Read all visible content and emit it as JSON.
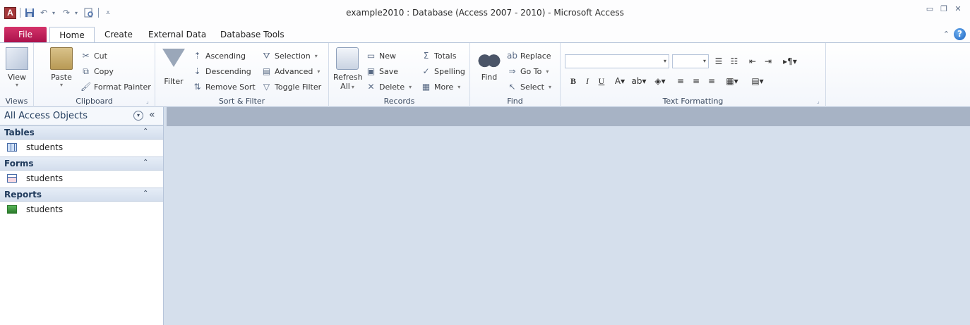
{
  "window": {
    "title": "example2010 : Database (Access 2007 - 2010)  -  Microsoft Access",
    "app_logo": "A",
    "controls": [
      "minimize-icon",
      "restore-icon",
      "close-icon"
    ]
  },
  "qat": {
    "icons": [
      "save-icon",
      "undo-icon",
      "redo-icon",
      "print-preview-icon",
      "customize-dropdown-icon"
    ]
  },
  "tabs": [
    {
      "key": "file",
      "label": "File"
    },
    {
      "key": "home",
      "label": "Home",
      "active": true
    },
    {
      "key": "create",
      "label": "Create"
    },
    {
      "key": "external",
      "label": "External Data"
    },
    {
      "key": "dbtools",
      "label": "Database Tools"
    }
  ],
  "ribbon": {
    "views": {
      "label": "Views",
      "view_btn": "View",
      "icon": "design-view-icon"
    },
    "clipboard": {
      "label": "Clipboard",
      "paste": "Paste",
      "cut": "Cut",
      "copy": "Copy",
      "format_painter": "Format Painter"
    },
    "sort_filter": {
      "label": "Sort & Filter",
      "filter": "Filter",
      "ascending": "Ascending",
      "descending": "Descending",
      "remove_sort": "Remove Sort",
      "selection": "Selection",
      "advanced": "Advanced",
      "toggle_filter": "Toggle Filter"
    },
    "records": {
      "label": "Records",
      "refresh": "Refresh",
      "refresh_sub": "All",
      "new": "New",
      "save": "Save",
      "delete": "Delete",
      "totals": "Totals",
      "spelling": "Spelling",
      "more": "More"
    },
    "find": {
      "label": "Find",
      "find": "Find",
      "replace": "Replace",
      "goto": "Go To",
      "select": "Select"
    },
    "text_formatting": {
      "label": "Text Formatting",
      "font_name": "",
      "font_size": "",
      "bold": "B",
      "italic": "I",
      "underline": "U"
    }
  },
  "nav": {
    "title": "All Access Objects",
    "groups": [
      {
        "label": "Tables",
        "items": [
          {
            "label": "students",
            "icon": "table-icon"
          }
        ]
      },
      {
        "label": "Forms",
        "items": [
          {
            "label": "students",
            "icon": "form-icon"
          }
        ]
      },
      {
        "label": "Reports",
        "items": [
          {
            "label": "students",
            "icon": "report-icon"
          }
        ]
      }
    ]
  },
  "colors": {
    "file_tab": "#b6174a",
    "workspace": "#d5dfec",
    "workspace_header": "#a7b3c5",
    "nav_text": "#1e395b"
  }
}
